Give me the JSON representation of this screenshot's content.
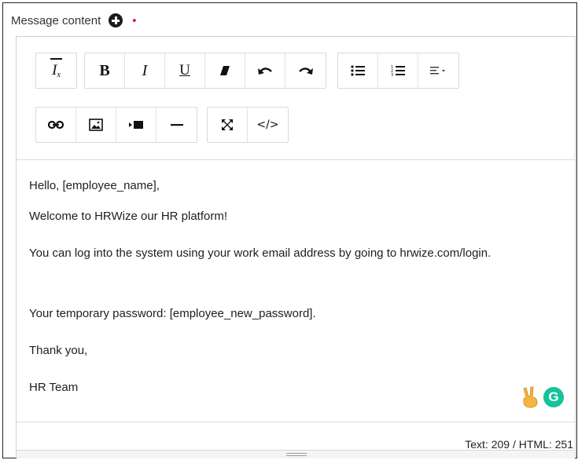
{
  "field": {
    "label": "Message content",
    "required_marker": "•"
  },
  "toolbar": {
    "row1": [
      {
        "name": "clear-format-button",
        "icon": "clear-format-icon"
      },
      {
        "name": "bold-button",
        "icon": "bold-icon",
        "glyph": "B"
      },
      {
        "name": "italic-button",
        "icon": "italic-icon",
        "glyph": "I"
      },
      {
        "name": "underline-button",
        "icon": "underline-icon",
        "glyph": "U"
      },
      {
        "name": "eraser-button",
        "icon": "eraser-icon"
      },
      {
        "name": "undo-button",
        "icon": "undo-icon"
      },
      {
        "name": "redo-button",
        "icon": "redo-icon"
      },
      {
        "name": "bullet-list-button",
        "icon": "bullet-list-icon"
      },
      {
        "name": "numbered-list-button",
        "icon": "numbered-list-icon"
      },
      {
        "name": "align-dropdown-button",
        "icon": "align-icon"
      }
    ],
    "row2": [
      {
        "name": "link-button",
        "icon": "link-icon"
      },
      {
        "name": "image-button",
        "icon": "image-icon"
      },
      {
        "name": "video-button",
        "icon": "video-icon"
      },
      {
        "name": "horizontal-rule-button",
        "icon": "horizontal-rule-icon"
      },
      {
        "name": "fullscreen-button",
        "icon": "fullscreen-icon"
      },
      {
        "name": "source-code-button",
        "icon": "code-icon",
        "glyph": "</>"
      }
    ],
    "clear_glyph": "I",
    "clear_sub": "x"
  },
  "content": {
    "greeting": "Hello, [employee_name],",
    "welcome": "Welcome to HRWize our HR platform!",
    "login_info": "You can log into the system using your work email address by going to hrwize.com/login.",
    "password_line": "Your temporary password: [employee_new_password].",
    "thanks": "Thank you,",
    "signature": "HR Team"
  },
  "extensions": {
    "emoji_icon": "victory-hand-icon",
    "grammarly_icon": "grammarly-icon",
    "grammarly_glyph": "G"
  },
  "status": {
    "counter": "Text: 209 / HTML: 251"
  },
  "colors": {
    "required": "#e0182e",
    "grammarly": "#15c39a",
    "victory_hand": "#f4b63f"
  }
}
